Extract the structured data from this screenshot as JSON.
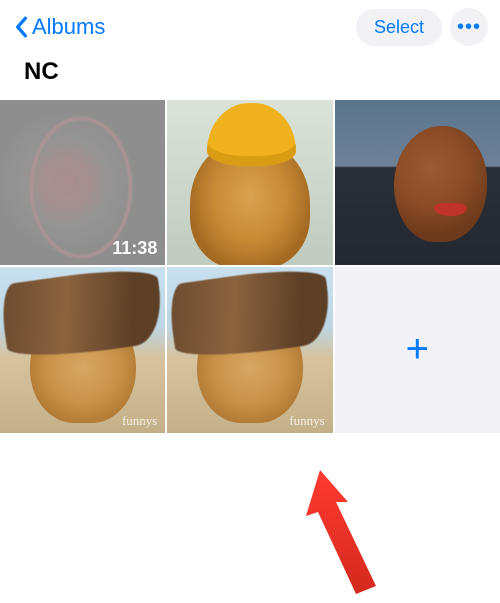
{
  "nav": {
    "back_label": "Albums",
    "select_label": "Select",
    "more_label": "•••"
  },
  "album": {
    "title": "NC"
  },
  "thumbs": {
    "video_duration": "11:38",
    "watermark": "funnys",
    "plus_glyph": "+"
  }
}
